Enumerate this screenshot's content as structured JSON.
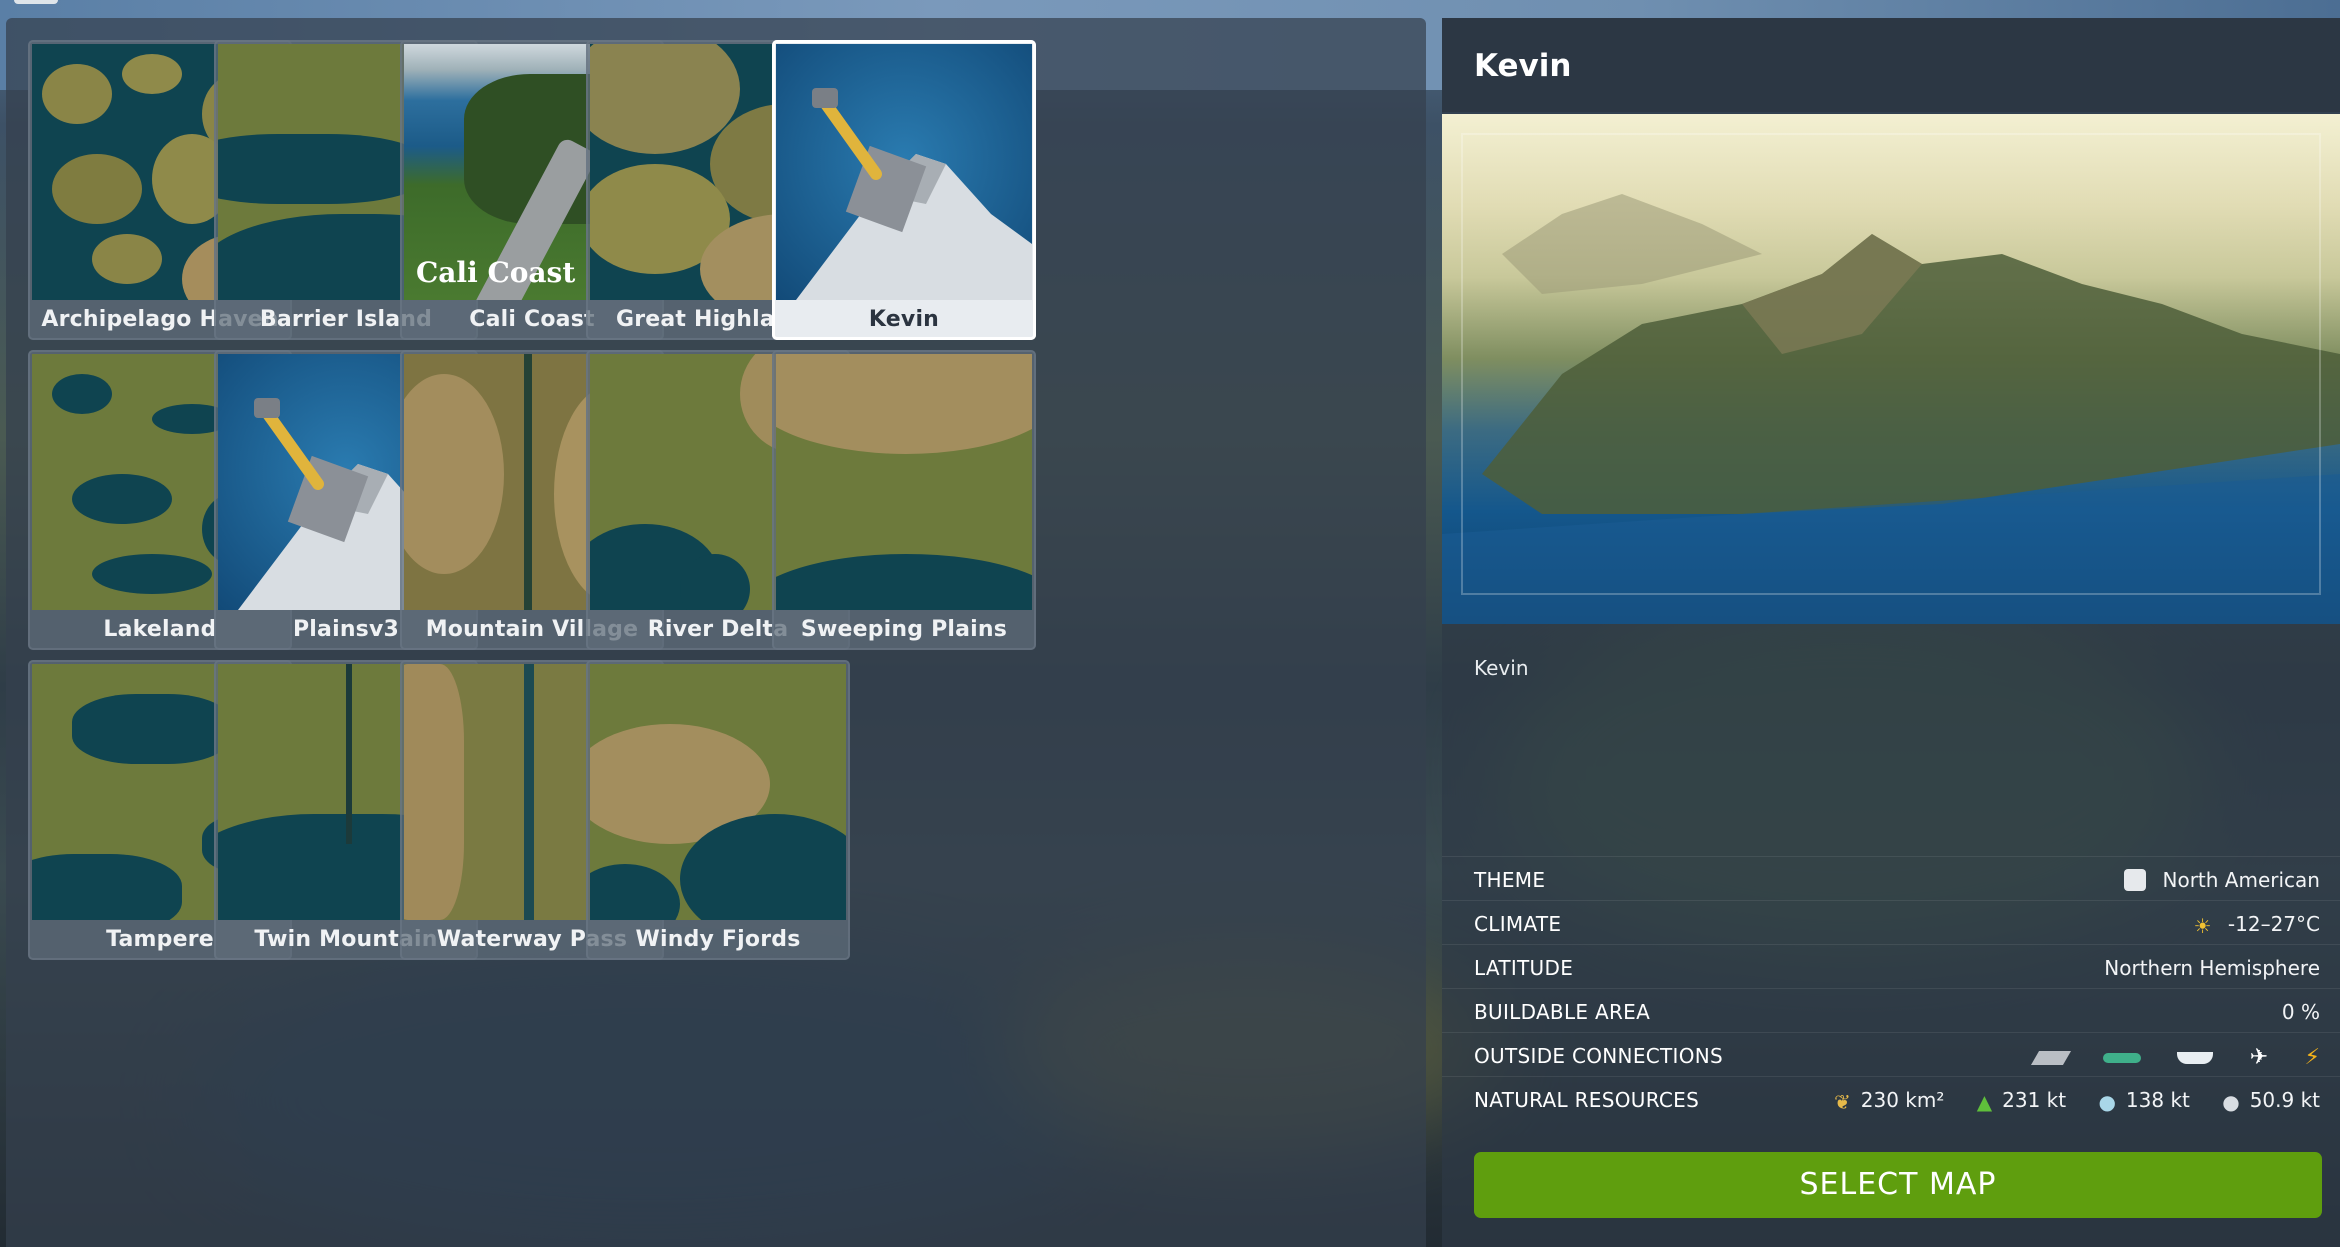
{
  "maps": [
    {
      "name": "Archipelago Haven",
      "theme": "archipelago"
    },
    {
      "name": "Barrier Island",
      "theme": "barrier"
    },
    {
      "name": "Cali Coast",
      "theme": "photo",
      "overlay": "Cali Coast"
    },
    {
      "name": "Great Highlands",
      "theme": "highlands"
    },
    {
      "name": "Kevin",
      "theme": "placeholder",
      "selected": true
    },
    {
      "name": "Lakeland",
      "theme": "lakeland"
    },
    {
      "name": "Plainsv3",
      "theme": "placeholder"
    },
    {
      "name": "Mountain Village",
      "theme": "mountain"
    },
    {
      "name": "River Delta",
      "theme": "delta"
    },
    {
      "name": "Sweeping Plains",
      "theme": "plains"
    },
    {
      "name": "Tampere",
      "theme": "tampere"
    },
    {
      "name": "Twin Mountain",
      "theme": "twin"
    },
    {
      "name": "Waterway Pass",
      "theme": "waterway"
    },
    {
      "name": "Windy Fjords",
      "theme": "fjords"
    }
  ],
  "details": {
    "title": "Kevin",
    "description": "Kevin",
    "rows": {
      "theme": {
        "label": "THEME",
        "value": "North American",
        "icon": "north-america-icon"
      },
      "climate": {
        "label": "CLIMATE",
        "value": "-12–27°C",
        "icon": "weather-icon"
      },
      "latitude": {
        "label": "LATITUDE",
        "value": "Northern Hemisphere"
      },
      "buildable": {
        "label": "BUILDABLE AREA",
        "value": "0 %"
      },
      "connections": {
        "label": "OUTSIDE CONNECTIONS",
        "icons": [
          "road-icon",
          "train-icon",
          "ship-icon",
          "airplane-icon",
          "electricity-icon"
        ]
      },
      "resources": {
        "label": "NATURAL RESOURCES",
        "fertile": "230 km²",
        "forest": "231 kt",
        "ore": "138 kt",
        "oil": "50.9 kt"
      }
    },
    "select_label": "SELECT MAP"
  },
  "colors": {
    "accent": "#5f9e0e",
    "water": "#0f4450",
    "land": "#6d7a3c",
    "placeholder_bg": "#1a5a8a",
    "shovel": "#e0b43c"
  }
}
